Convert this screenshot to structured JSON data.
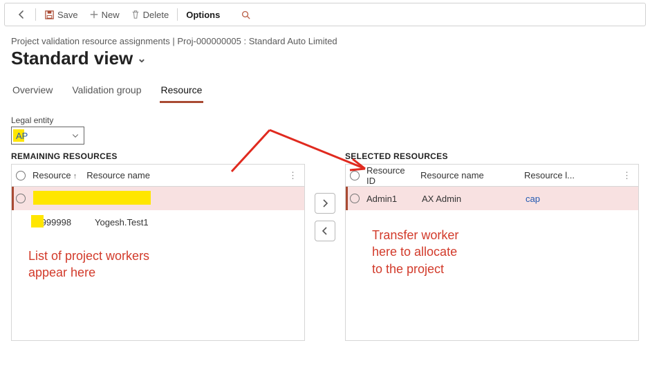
{
  "toolbar": {
    "save": "Save",
    "new": "New",
    "delete": "Delete",
    "options": "Options"
  },
  "breadcrumb": "Project validation resource assignments   |   Proj-000000005 : Standard Auto Limited",
  "page_title": "Standard view",
  "tabs": [
    "Overview",
    "Validation group",
    "Resource"
  ],
  "active_tab": 2,
  "legal_entity": {
    "label": "Legal entity",
    "value": "AP"
  },
  "left_panel": {
    "title": "REMAINING RESOURCES",
    "headers": [
      "Resource",
      "Resource name"
    ],
    "rows": [
      {
        "resource": "",
        "name": ""
      },
      {
        "resource": "P999998",
        "name": "Yogesh.Test1"
      }
    ]
  },
  "right_panel": {
    "title": "SELECTED RESOURCES",
    "headers": [
      "Resource ID",
      "Resource name",
      "Resource l..."
    ],
    "rows": [
      {
        "id": "Admin1",
        "name": "AX Admin",
        "legal": "cap"
      }
    ]
  },
  "annotations": {
    "left": "List of project workers\nappear here",
    "right": "Transfer worker\nhere to allocate\nto the project"
  }
}
